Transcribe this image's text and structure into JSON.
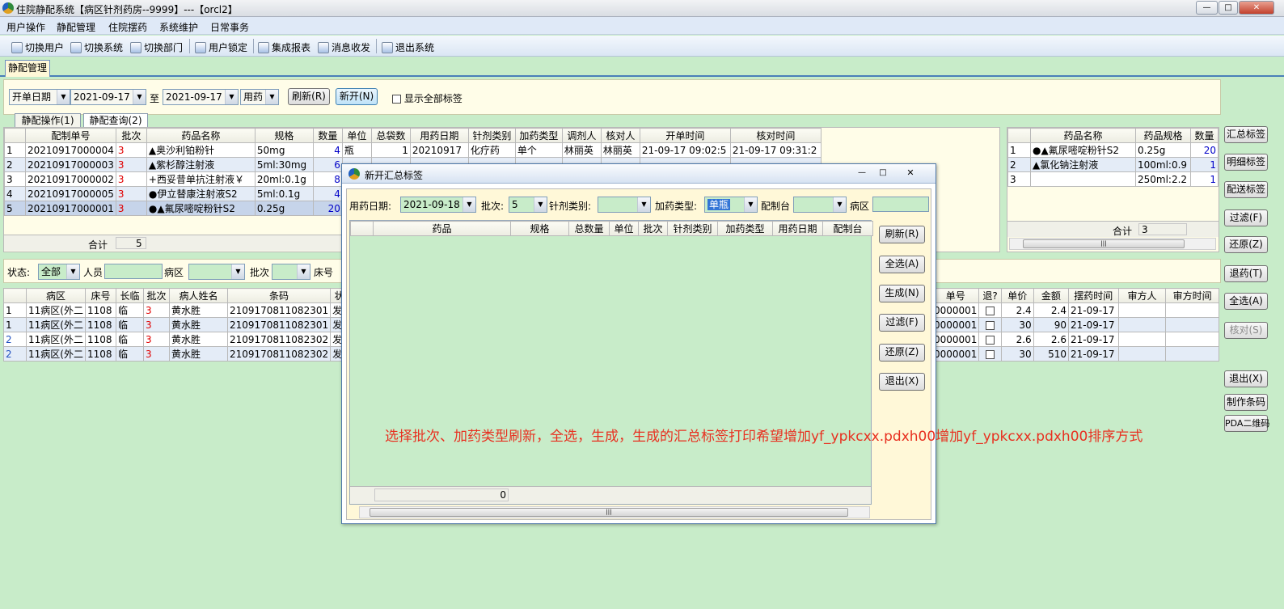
{
  "window": {
    "title": "住院静配系统【病区针剂药房--9999】---【orcl2】",
    "min": "—",
    "max": "□",
    "close": "✕"
  },
  "menu": [
    "用户操作",
    "静配管理",
    "住院摆药",
    "系统维护",
    "日常事务"
  ],
  "toolbar": [
    "切换用户",
    "切换系统",
    "切换部门",
    "用户锁定",
    "集成报表",
    "消息收发",
    "退出系统"
  ],
  "main_tab": "静配管理",
  "filter": {
    "date_type": "开单日期",
    "date_from": "2021-09-17",
    "to_label": "至",
    "date_to": "2021-09-17",
    "usage": "用药",
    "refresh": "刷新(R)",
    "new": "新开(N)",
    "show_all_label": "显示全部标签"
  },
  "subtabs": [
    "静配操作(1)",
    "静配查询(2)"
  ],
  "main_grid": {
    "headers": [
      "",
      "配制单号",
      "批次",
      "药品名称",
      "规格",
      "数量",
      "单位",
      "总袋数",
      "用药日期",
      "针剂类别",
      "加药类型",
      "调剂人",
      "核对人",
      "开单时间",
      "核对时间"
    ],
    "rows": [
      [
        "1",
        "20210917000004",
        "3",
        "▲奥沙利铂粉针",
        "50mg",
        "4",
        "瓶",
        "1",
        "20210917",
        "化疗药",
        "单个",
        "林丽英",
        "林丽英",
        "21-09-17 09:02:5",
        "21-09-17 09:31:2"
      ],
      [
        "2",
        "20210917000003",
        "3",
        "▲紫杉醇注射液",
        "5ml:30mg",
        "6",
        "",
        "",
        "",
        "",
        "",
        "",
        "",
        "",
        ""
      ],
      [
        "3",
        "20210917000002",
        "3",
        "+西妥昔单抗注射液￥",
        "20ml:0.1g",
        "8",
        "",
        "",
        "",
        "",
        "",
        "",
        "",
        "",
        ""
      ],
      [
        "4",
        "20210917000005",
        "3",
        "●伊立替康注射液S2",
        "5ml:0.1g",
        "4",
        "",
        "",
        "",
        "",
        "",
        "",
        "",
        "",
        ""
      ],
      [
        "5",
        "20210917000001",
        "3",
        "●▲氟尿嘧啶粉针S2",
        "0.25g",
        "20",
        "",
        "",
        "",
        "",
        "",
        "",
        "",
        "",
        ""
      ]
    ],
    "total_label": "合计",
    "total_value": "5"
  },
  "right_grid": {
    "headers": [
      "",
      "药品名称",
      "药品规格",
      "数量"
    ],
    "rows": [
      [
        "1",
        "●▲氟尿嘧啶粉针S2",
        "0.25g",
        "20"
      ],
      [
        "2",
        "▲氯化钠注射液",
        "100ml:0.9",
        "1"
      ],
      [
        "3",
        "",
        "250ml:2.2",
        "1"
      ]
    ],
    "total_label": "合计",
    "total_value": "3"
  },
  "side_buttons": [
    "汇总标签",
    "明细标签",
    "配送标签",
    "过滤(F)",
    "还原(Z)",
    "退药(T)",
    "全选(A)",
    "核对(S)",
    "退出(X)",
    "制作条码",
    "PDA二维码"
  ],
  "status_row": {
    "status_label": "状态:",
    "status_value": "全部",
    "person_label": "人员",
    "ward_label": "病区",
    "batch_label": "批次",
    "bed_label": "床号"
  },
  "lower_grid": {
    "headers": [
      "",
      "病区",
      "床号",
      "长临",
      "批次",
      "病人姓名",
      "条码",
      "状态"
    ],
    "rows": [
      [
        "1",
        "11病区(外二",
        "1108",
        "临",
        "3",
        "黄水胜",
        "2109170811082301",
        "发药"
      ],
      [
        "1",
        "11病区(外二",
        "1108",
        "临",
        "3",
        "黄水胜",
        "2109170811082301",
        "发药"
      ],
      [
        "2",
        "11病区(外二",
        "1108",
        "临",
        "3",
        "黄水胜",
        "2109170811082302",
        "发药"
      ],
      [
        "2",
        "11病区(外二",
        "1108",
        "临",
        "3",
        "黄水胜",
        "2109170811082302",
        "发药"
      ]
    ],
    "right_headers": [
      "单号",
      "退?",
      "单价",
      "金额",
      "摆药时间",
      "审方人",
      "审方时间"
    ],
    "right_rows": [
      [
        "0000001",
        "",
        "2.4",
        "2.4",
        "21-09-17",
        "",
        ""
      ],
      [
        "0000001",
        "",
        "30",
        "90",
        "21-09-17",
        "",
        ""
      ],
      [
        "0000001",
        "",
        "2.6",
        "2.6",
        "21-09-17",
        "",
        ""
      ],
      [
        "0000001",
        "",
        "30",
        "510",
        "21-09-17",
        "",
        ""
      ]
    ]
  },
  "dialog": {
    "title": "新开汇总标签",
    "date_label": "用药日期:",
    "date_value": "2021-09-18",
    "batch_label": "批次:",
    "batch_value": "5",
    "inj_label": "针剂类别:",
    "inj_value": "",
    "add_label": "加药类型:",
    "add_value": "单瓶",
    "station_label": "配制台",
    "station_value": "",
    "ward_label": "病区",
    "headers": [
      "",
      "药品",
      "规格",
      "总数量",
      "单位",
      "批次",
      "针剂类别",
      "加药类型",
      "用药日期",
      "配制台"
    ],
    "footer_value": "0",
    "buttons": [
      "刷新(R)",
      "全选(A)",
      "生成(N)",
      "过滤(F)",
      "还原(Z)",
      "退出(X)"
    ]
  },
  "note": "选择批次、加药类型刷新，全选，生成，生成的汇总标签打印希望增加yf_ypkcxx.pdxh00增加yf_ypkcxx.pdxh00排序方式",
  "colors": {
    "background": "#c8ecc9",
    "accent": "#e83020",
    "batch": "#e00000",
    "qty": "#0000c8"
  }
}
